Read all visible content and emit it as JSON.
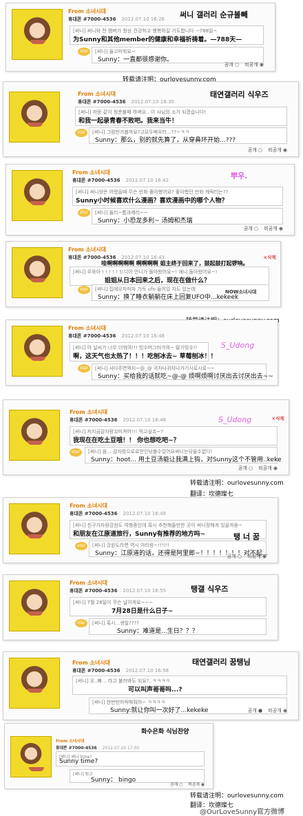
{
  "from_label": "From 소녀시대",
  "user_label": "휴대폰 #7000-4536",
  "control_labels": {
    "public": "공개",
    "private": "비공개"
  },
  "credit_lines": {
    "repost": "转载请注明：ourlovesunny.com",
    "translate": "翻译：坎德璨七"
  },
  "watermark": "@OurLoveSunny官方微博",
  "posts": [
    {
      "title": "써니 갤러리 순규볼빼",
      "date": "2012.07.10 16:26",
      "q_small": "[써니] 써니와 전 멤버가 항상 건강하고 행복하길 기도합니다 ~788일~",
      "q_zh": "为Sunny和其他member的健康和幸福祈祷着。—788天—",
      "a_small": "[써니] 들고마워요~",
      "a_zh": "Sunny：一直都很感谢你。"
    },
    {
      "title": "태연갤러리 식우즈",
      "date": "2012.07.10 16:30",
      "q_small": "[써니] 저랑 같이 청춘불패 하며요.. 이 사님의 소가 되겠습니다!",
      "q_zh": "和我一起录青春不败吧。我来当牛！",
      "a_small": "[써니] 그럼만가볼까요?고모두배우터...??~ㅋㅋ",
      "a_zh": "Sunny：那么，别的就先算了，从穿鼻环开始...???"
    },
    {
      "title": "뿌우.",
      "date": "2012.07.10 16:42",
      "q_small": "[써니] 써니양은 어렸을때 무슨 만화 좋아했어요? 좋아했던 만화 캐릭터는??",
      "q_zh": "Sunny小时候喜欢什么漫画？喜欢漫画中的哪个人物？",
      "a_small": "[써니] 둘리~톰과제리~~",
      "a_zh": "Sunny：小恐龙多利~ 汤姆和杰瑞"
    },
    {
      "title": "NOW소녀시대",
      "date": "2012.07.10 16:43",
      "q_small": "[써니] 우와아 ! ! ! ! ! 드디어 언니가 돌아왔어요~! 애니 돌아왔어요~!",
      "q_zh": "姐姐从日本回来之后，现在在做什么？",
      "a_small": "[써니] 집에오자마자 가득 ufo 들어있 자도 있는데",
      "a_zh": "Sunny：换了睡衣躺躺在床上回复UFO中...kekeek",
      "extra_line": "哇啊啊啊啊啊 啊啊啊啊 姐主终于回来了，鼓起鼓打起锣响。"
    },
    {
      "title": "S_Udong",
      "date": "2012.07.10 16:48",
      "q_small": "[써니] 아 날씨가 너무 더워여!!! 빙수머그러가여~ 딸기빙수!!",
      "q_zh": "啊，这天气也太热了！！！吃刨冰去~ 草莓刨冰！！",
      "a_small": "[써니] 사다주면먹지~@_@ 귀차나귀차나가기시로시로~~",
      "a_zh": "Sunny：买给我的话就吃~@-@ 烦啊烦啊讨厌出去讨厌出去~~"
    },
    {
      "title": "S_Udong",
      "date": "2012.07.10 16:48",
      "q_small": "[써니] 저지금감자랑꼬미쳐어!!! 먹고싶죠~?",
      "q_zh": "我现在在吃土豆哦！！ 你也想吃吧~？",
      "a_small": "[써니] 음... 감자랑으로로언인낚불수있어요써니는낚을수없다!",
      "a_zh": "Sunny：hoot... 用土豆汤能让我满上钩，对Sunny这个不管用..keke"
    },
    {
      "title": "탱 너 꿈",
      "date": "2012.07.10 16:49",
      "q_small": "[써니] 친구가자랑강원도 여행중인데 혹시 추천해줄만한 곳이 써니정해게 있을까용~",
      "q_zh": "和朋友在江原道旅行，Sunny有推荐的地方吗~",
      "a_small": "[써니] 강원도라면 역시 아리랑~!!!!!!",
      "a_zh": "Sunny：江原道的话，还得是阿里郎~！！！！！！！对不起..."
    },
    {
      "title": "탱갤 식우즈",
      "date": "2012.07.10 16:55",
      "q_small": "[써니] 7월 28일이 무슨 날이게요~~~",
      "q_zh": "7月28日是什么日子~",
      "a_small": "[써니] 혹시...생일????",
      "a_zh": "Sunny：难道是...生日？？？"
    },
    {
      "title": "태연갤러리 꿈탱님",
      "date": "2012.07.10 16:58",
      "q_small": "[써니] 오..빠 .. 라고 불러봐도 되요?..ㅋㅋㅋㅋ",
      "q_zh": "可以叫声哥哥吗...?",
      "a_small": "[써니] 한번만허락해줘어~ ㅋㅋㅋㅋ",
      "a_zh": "Sunny:就让你叫一次好了...kekeke"
    },
    {
      "title": "화수은화 식님찬양",
      "date": "2012.07.10 17:00",
      "q_small": "[써니] 써니 time?",
      "q_zh": "Sunny time?",
      "a_small": "[써니] 빙고",
      "a_zh": "Sunny： bingo"
    }
  ]
}
